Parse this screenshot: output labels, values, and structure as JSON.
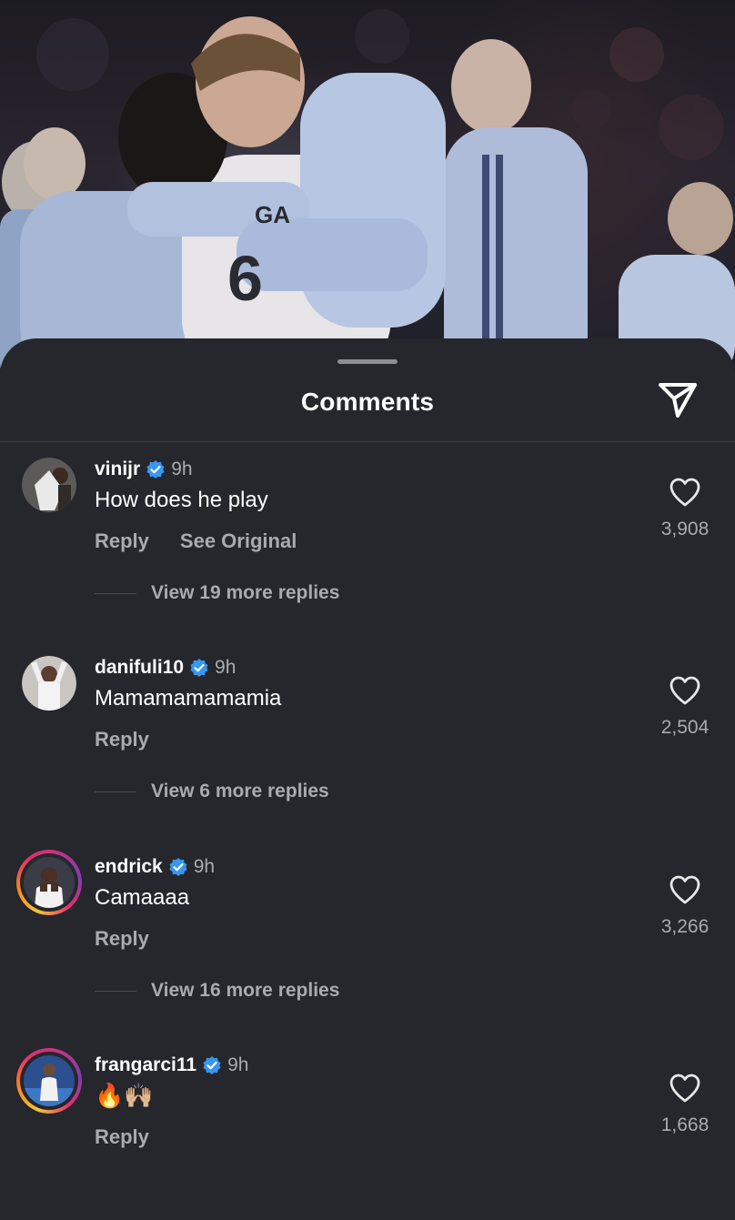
{
  "header": {
    "title": "Comments"
  },
  "icons": {
    "send": "send-icon",
    "heart": "heart-outline-icon",
    "verified": "verified-badge-icon"
  },
  "colors": {
    "sheet_bg": "#25272c",
    "secondary_text": "#a8abb0",
    "verified_blue": "#3897f0"
  },
  "comments": [
    {
      "username": "vinijr",
      "time": "9h",
      "text": "How does he play",
      "reply": "Reply",
      "see_original": "See Original",
      "likes": "3,908",
      "view_replies": "View 19 more replies"
    },
    {
      "username": "danifuli10",
      "time": "9h",
      "text": "Mamamamamamia",
      "reply": "Reply",
      "likes": "2,504",
      "view_replies": "View 6 more replies"
    },
    {
      "username": "endrick",
      "time": "9h",
      "text": "Camaaaa",
      "reply": "Reply",
      "likes": "3,266",
      "view_replies": "View 16 more replies"
    },
    {
      "username": "frangarci11",
      "time": "9h",
      "text": "🔥🙌🏼",
      "reply": "Reply",
      "likes": "1,668"
    }
  ]
}
